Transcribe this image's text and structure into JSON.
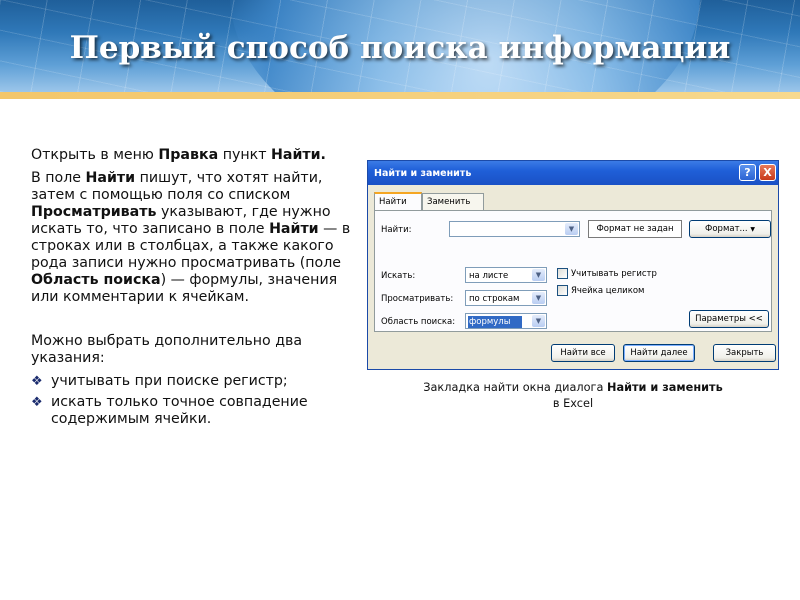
{
  "slide": {
    "title": "Первый способ поиска информации"
  },
  "left_text": {
    "p1_a": "Открыть в меню ",
    "p1_b": "Правка",
    "p1_c": "  пункт ",
    "p1_d": "Найти.",
    "p2_a": "В поле ",
    "p2_b": "Найти",
    "p2_c": " пишут, что хотят найти, затем с помощью поля со списком ",
    "p2_d": "Просматривать",
    "p2_e": " указывают, где нужно искать то, что записано в поле ",
    "p2_f": "Найти",
    "p2_g": " — в строках или в столбцах, а также какого рода записи нужно просматривать (поле ",
    "p2_h": "Область поиска",
    "p2_i": ") — формулы, значения или комментарии к ячейкам.",
    "p3": "Можно выбрать дополнительно два указания:",
    "bullet_mark": "❖",
    "bullets": [
      "учитывать при поиске регистр;",
      "искать только точное совпадение содержимым ячейки."
    ]
  },
  "dialog": {
    "title": "Найти и заменить",
    "help": "?",
    "close": "X",
    "tabs": [
      "Найти",
      "Заменить"
    ],
    "find_label": "Найти:",
    "find_value": "",
    "format_status": "Формат не задан",
    "format_button": "Формат...",
    "search_label": "Искать:",
    "search_value": "на листе",
    "look_label": "Просматривать:",
    "look_value": "по строкам",
    "area_label": "Область поиска:",
    "area_value": "формулы",
    "match_case": "Учитывать регистр",
    "whole_cell": "Ячейка целиком",
    "params_button": "Параметры <<",
    "find_all": "Найти все",
    "find_next": "Найти далее",
    "close_button": "Закрыть",
    "arrow": "▼"
  },
  "caption": {
    "a": "Закладка найти окна диалога ",
    "b": "Найти и заменить",
    "c": "в Excel"
  }
}
